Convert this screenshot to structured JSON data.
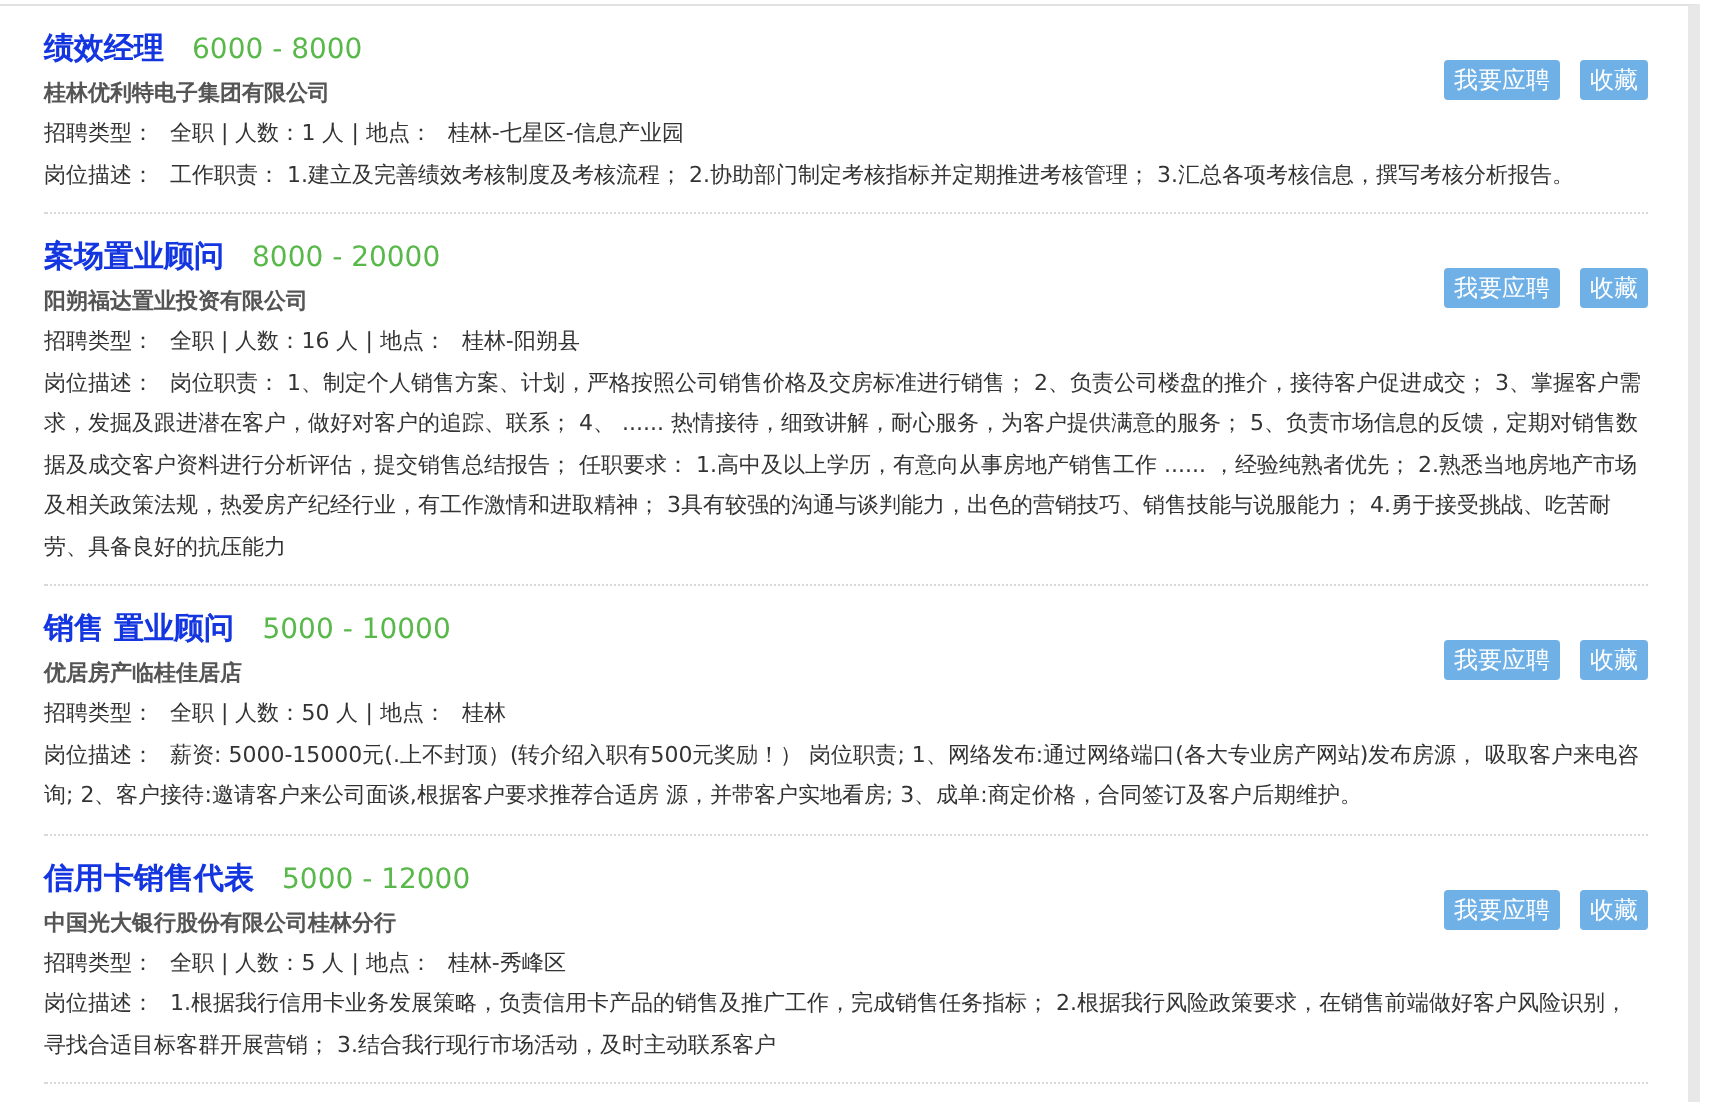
{
  "jobs": [
    {
      "title": "绩效经理",
      "salary": "6000 - 8000",
      "company": "桂林优利特电子集团有限公司",
      "type_label": "招聘类型：",
      "type_value": "全职 | 人数：1 人 | 地点：",
      "location": "桂林-七星区-信息产业园",
      "desc_label": "岗位描述：",
      "desc": "工作职责： 1.建立及完善绩效考核制度及考核流程； 2.协助部门制定考核指标并定期推进考核管理； 3.汇总各项考核信息，撰写考核分析报告。",
      "apply": "我要应聘",
      "save": "收藏"
    },
    {
      "title": "案场置业顾问",
      "salary": "8000 - 20000",
      "company": "阳朔福达置业投资有限公司",
      "type_label": "招聘类型：",
      "type_value": "全职 | 人数：16 人 | 地点：",
      "location": "桂林-阳朔县",
      "desc_label": "岗位描述：",
      "desc": "岗位职责： 1、制定个人销售方案、计划，严格按照公司销售价格及交房标准进行销售； 2、负责公司楼盘的推介，接待客户促进成交； 3、掌握客户需求，发掘及跟进潜在客户，做好对客户的追踪、联系； 4、 ...... 热情接待，细致讲解，耐心服务，为客户提供满意的服务； 5、负责市场信息的反馈，定期对销售数据及成交客户资料进行分析评估，提交销售总结报告； 任职要求： 1.高中及以上学历，有意向从事房地产销售工作 ...... ，经验纯熟者优先； 2.熟悉当地房地产市场及相关政策法规，热爱房产纪经行业，有工作激情和进取精神； 3具有较强的沟通与谈判能力，出色的营销技巧、销售技能与说服能力； 4.勇于接受挑战、吃苦耐劳、具备良好的抗压能力",
      "apply": "我要应聘",
      "save": "收藏"
    },
    {
      "title": "销售 置业顾问",
      "salary": "5000 - 10000",
      "company": "优居房产临桂佳居店",
      "type_label": "招聘类型：",
      "type_value": "全职 | 人数：50 人 | 地点：",
      "location": "桂林",
      "desc_label": "岗位描述：",
      "desc": "薪资: 5000-15000元(.上不封顶）(转介绍入职有500元奖励！） 岗位职责; 1、网络发布:通过网络端口(各大专业房产网站)发布房源， 吸取客户来电咨询; 2、客户接待:邀请客户来公司面谈,根据客户要求推荐合适房 源，并带客户实地看房; 3、成单:商定价格，合同签订及客户后期维护。",
      "apply": "我要应聘",
      "save": "收藏"
    },
    {
      "title": "信用卡销售代表",
      "salary": "5000 - 12000",
      "company": "中国光大银行股份有限公司桂林分行",
      "type_label": "招聘类型：",
      "type_value": "全职 | 人数：5 人 | 地点：",
      "location": "桂林-秀峰区",
      "desc_label": "岗位描述：",
      "desc": "1.根据我行信用卡业务发展策略，负责信用卡产品的销售及推广工作，完成销售任务指标； 2.根据我行风险政策要求，在销售前端做好客户风险识别，寻找合适目标客群开展营销； 3.结合我行现行市场活动，及时主动联系客户",
      "apply": "我要应聘",
      "save": "收藏"
    }
  ]
}
